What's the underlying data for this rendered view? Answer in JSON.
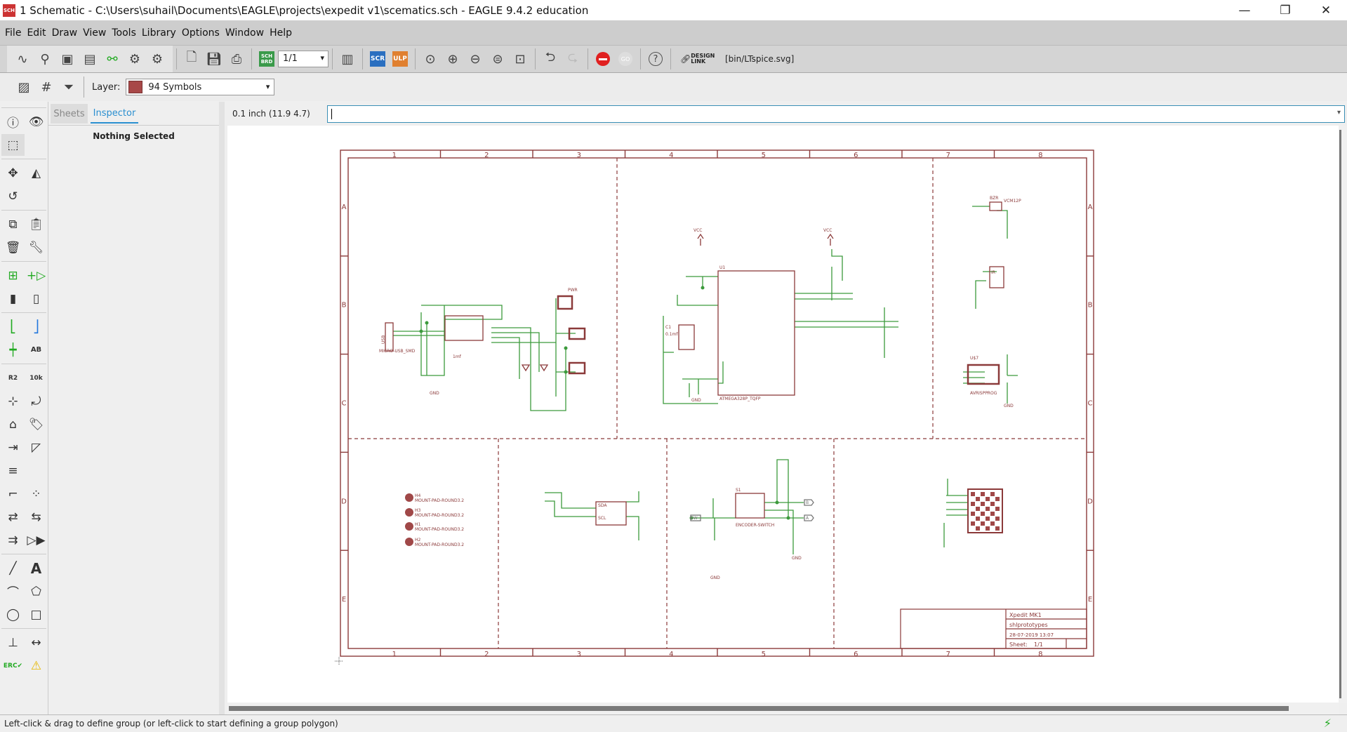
{
  "window": {
    "title": "1 Schematic - C:\\Users\\suhail\\Documents\\EAGLE\\projects\\expedit v1\\scematics.sch - EAGLE 9.4.2 education",
    "app_icon": "SCH",
    "minimize": "—",
    "restore": "❐",
    "close": "✕"
  },
  "menu": [
    "File",
    "Edit",
    "Draw",
    "View",
    "Tools",
    "Library",
    "Options",
    "Window",
    "Help"
  ],
  "toolbar": {
    "sheet_value": "1/1",
    "sch_brd": "SCH BRD",
    "scr": "SCR",
    "ulp": "ULP",
    "go": "GO",
    "design_link": "DESIGN LINK",
    "ulp_path": "[bin/LTspice.svg]",
    "stop_color": "#e02020"
  },
  "toolbar2": {
    "layer_label": "Layer:",
    "layer_value": "94 Symbols",
    "layer_color": "#a84848"
  },
  "panel": {
    "tabs": [
      "Sheets",
      "Inspector"
    ],
    "active_tab": "Inspector",
    "message": "Nothing Selected"
  },
  "command": {
    "grid_readout": "0.1 inch (11.9 4.7)",
    "value": ""
  },
  "status": {
    "message": "Left-click & drag to define group (or left-click to start defining a group polygon)"
  },
  "schematic": {
    "columns": [
      "1",
      "2",
      "3",
      "4",
      "5",
      "6",
      "7",
      "8"
    ],
    "rows": [
      "A",
      "B",
      "C",
      "D",
      "E"
    ],
    "frame_color": "#8b3a3a",
    "wire_color": "#3c9a3c",
    "labels": {
      "usb": "USB",
      "usb_part": "MICRO-USB_SMD",
      "u1": "U1",
      "mcu": "ATMEGA328P_TQFP",
      "c1": "C1",
      "c1_val": "0.1mf",
      "c4_val": "1mf",
      "pwr": "PWR",
      "s1": "S1",
      "encoder": "ENCODER-SWITCH",
      "sw": "SW",
      "a": "A",
      "b": "B",
      "avr_ref": "U$7",
      "avr": "AVRISPPROG",
      "bzr": "BZR",
      "bzr_part": "VCM12P",
      "sda": "SDA",
      "scl": "SCL",
      "vcc": "VCC",
      "gnd": "GND",
      "ir": "IR"
    },
    "mount_pads": [
      {
        "ref": "H4",
        "part": "MOUNT-PAD-ROUND3.2"
      },
      {
        "ref": "H3",
        "part": "MOUNT-PAD-ROUND3.2"
      },
      {
        "ref": "H1",
        "part": "MOUNT-PAD-ROUND3.2"
      },
      {
        "ref": "H2",
        "part": "MOUNT-PAD-ROUND3.2"
      }
    ],
    "title_block": {
      "title": "Xpedit MK1",
      "company": "shlprototypes",
      "date": "28-07-2019 13:07",
      "sheet_label": "Sheet:",
      "sheet_value": "1/1"
    }
  }
}
